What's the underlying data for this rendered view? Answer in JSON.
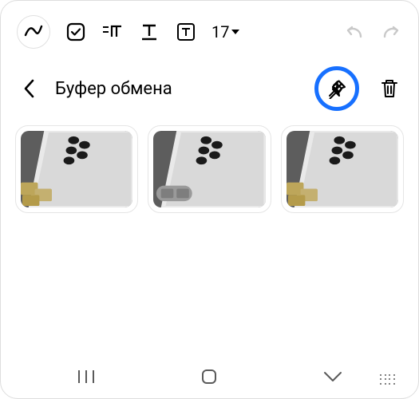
{
  "toolbar": {
    "font_size": "17"
  },
  "clipboard": {
    "title": "Буфер обмена",
    "items": [
      {
        "id": 1
      },
      {
        "id": 2
      },
      {
        "id": 3
      }
    ]
  },
  "highlight": {
    "ring_color": "#1770ff"
  }
}
